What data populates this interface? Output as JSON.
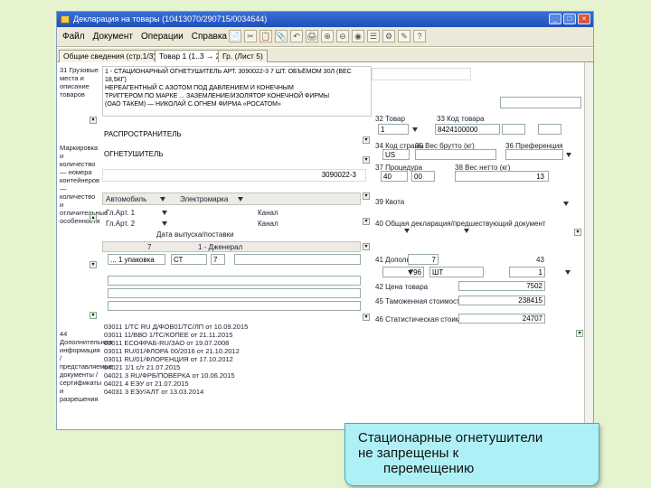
{
  "window": {
    "title": "Декларация на товары (10413070/290715/0034644)",
    "buttons": [
      "_",
      "□",
      "×"
    ]
  },
  "menubar": {
    "items": [
      "Файл",
      "Документ",
      "Операции",
      "Справка"
    ],
    "toolbar_icons": [
      "📄",
      "✂",
      "📋",
      "📎",
      "↶",
      "🖨",
      "⊕",
      "⊖",
      "◉",
      "☰",
      "⚙",
      "✎",
      "?"
    ]
  },
  "tabs": [
    {
      "label": "Общие сведения (стр.1/3)",
      "active": false
    },
    {
      "label": "Товар 1 (1..3 → 2)",
      "active": true
    },
    {
      "label": "Гр. (Лист 5)",
      "active": false
    }
  ],
  "left_labels": {
    "g31": "31 Грузовые места и описание товаров",
    "marking": "Маркировка и количество — номера контейнеров — количество и отличительные особенности",
    "g44": "44 Дополнительная информация / представляемые документы / сертификаты и разрешения"
  },
  "description": {
    "line1": "1 - СТАЦИОНАРНЫЙ ОГНЕТУШИТЕЛЬ АРТ. 3090022-3 7 ШТ. ОБЪЁМОМ 30Л (ВЕС 18,5КГ)",
    "line2": "НЕРЕАГЕНТНЫЙ С АЗОТОМ ПОД ДАВЛЕНИЕМ И КОНЕЧНЫМ",
    "line3": "ТРИГГЕРОМ ПО МАРКЕ ... ЗАЗЕМЛЕНИЕ/ИЗОЛЯТОР КОНЕЧНОЙ ФИРМЫ",
    "line4": "(ОАО ТАКЕМ) — НИКОЛАЙ С.ОГНЕМ ФИРМА «РОСАТОМ»",
    "line5": "РАСПРОСТРАНИТЕЛЬ",
    "line6": "ОГНЕТУШИТЕЛЬ",
    "line7": "3090022-3"
  },
  "fields": {
    "g32_label": "32 Товар",
    "g32_value": "1",
    "g33_label": "33 Код товара",
    "g33_value": "8424100000",
    "g34_label": "34 Код страны",
    "g34_value": "US",
    "g35_label": "35 Вес брутто (кг)",
    "g36_label": "36 Преференция",
    "g37_label": "37 Процедура",
    "g37_a": "40",
    "g37_b": "00",
    "g38_label": "38 Вес нетто (кг)",
    "g38_value": "13",
    "g39_label": "39 Квота",
    "g40_label": "40 Общая декларация/предшествующий документ",
    "g41_label": "41 Дополн. ед.",
    "g41_value": "7",
    "g41_unit": "ШТ",
    "g43_label": "43",
    "g43_value": "1",
    "g42_label": "42 Цена товара",
    "g42_value": "7502",
    "g45_label": "45 Таможенная стоимость",
    "g45_value": "238415",
    "g46_label": "46 Статистическая стоимость",
    "g46_value": "24707",
    "code_796": "796"
  },
  "transport": {
    "type_a": "Автомобиль",
    "type_b": "Электромарка",
    "gl_art1": "Гл.Арт. 1",
    "gl_art2": "Гл.Арт. 2",
    "kanal1": "Канал",
    "kanal2": "Канал",
    "supplier": "Дата выпуска/поставки",
    "manufacturer": "1 - Дженерал",
    "num_7": "7",
    "package": "... 1 упаковка",
    "st": "СТ",
    "st_val": "7"
  },
  "documents": [
    "03011 1/ТС RU Д/ФОВ01/ТС/ЛП от 10.09.2015",
    "03011 11/ВВО 1/ТС/КОПЕЕ от 21.11.2015",
    "03011 ЕСОФРАБ-RU/ЗАО от 19.07.2008",
    "03011 RU/01/ФЛОРА 00/2016 от 21.10.2012",
    "03011 RU/01/ФЛОРЕНЦИЯ от 17.10.2012",
    "04021 1/1 с/т 21.07.2015",
    "04021 3 RU/ФРБ/ПОВЕРКА от 10.06.2015",
    "04021 4 ЕЭУ от 21.07.2015",
    "04031 3 ЕЭУ/АЛТ от 13.03.2014"
  ],
  "tooltip": {
    "line1": "Стационарные огнетушители",
    "line2": "не запрещены к",
    "line3": "перемещению"
  }
}
